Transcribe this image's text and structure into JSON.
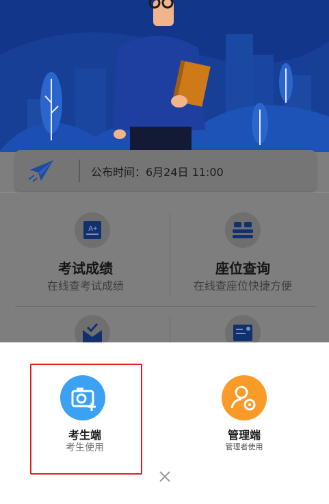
{
  "notice": {
    "text": "公布时间：6月24日 11:00",
    "icon": "paper-plane-icon"
  },
  "features": [
    {
      "title": "考试成绩",
      "subtitle": "在线查考试成绩",
      "icon": "score-card-icon"
    },
    {
      "title": "座位查询",
      "subtitle": "在线查座位快捷方便",
      "icon": "seats-icon"
    },
    {
      "icon": "mail-check-icon"
    },
    {
      "icon": "certificate-icon"
    }
  ],
  "roles": [
    {
      "title": "考生端",
      "subtitle": "考生使用",
      "icon": "camera-plus-icon",
      "color": "#3ba1f3",
      "selected": true
    },
    {
      "title": "管理端",
      "subtitle": "管理者使用",
      "icon": "user-gear-icon",
      "color": "#fa9a28",
      "selected": false
    }
  ],
  "colors": {
    "selection_outline": "#e02020",
    "sheet_background": "#ffffff",
    "hero_background": "#153f93"
  }
}
